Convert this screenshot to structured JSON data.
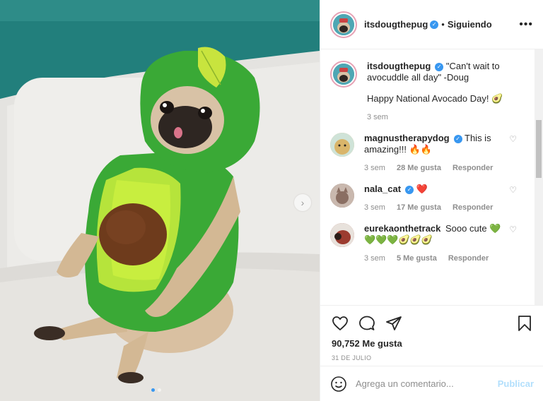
{
  "post": {
    "username": "itsdougthepug",
    "follow_separator": "•",
    "follow_status": "Siguiendo",
    "more_icon": "more-options-icon"
  },
  "caption": {
    "username": "itsdougthepug",
    "text": "\"Can't wait to avocuddle all day\" -Doug",
    "line2": "Happy National Avocado Day! 🥑",
    "time": "3 sem"
  },
  "comments": [
    {
      "username": "magnustherapydog",
      "text": "This is amazing!!! 🔥🔥",
      "time": "3 sem",
      "likes": "28 Me gusta",
      "reply": "Responder",
      "avatar_color": "#d9b56a"
    },
    {
      "username": "nala_cat",
      "text": "❤️",
      "time": "3 sem",
      "likes": "17 Me gusta",
      "reply": "Responder",
      "avatar_color": "#8a6e62"
    },
    {
      "username": "eurekaonthetrack",
      "text": "Sooo cute 💚💚💚💚🥑🥑🥑",
      "time": "3 sem",
      "likes": "5 Me gusta",
      "reply": "Responder",
      "avatar_color": "#9c3b2f"
    }
  ],
  "stats": {
    "likes": "90,752 Me gusta",
    "date": "31 DE JULIO"
  },
  "add_comment": {
    "placeholder": "Agrega un comentario...",
    "publish": "Publicar"
  },
  "colors": {
    "accent": "#3897f0",
    "publish_disabled": "#b2dffc",
    "avatar_ring": "#e6a2b5"
  }
}
